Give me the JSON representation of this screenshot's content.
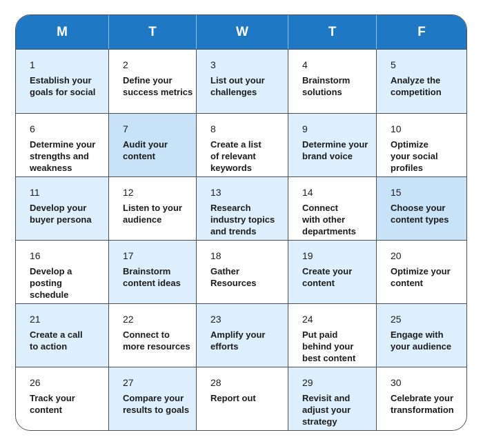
{
  "colors": {
    "header": "#1f78c4",
    "light": "#ddeffd",
    "mid": "#c8e2f7",
    "white": "#ffffff",
    "border": "#4a4f55"
  },
  "days": [
    "M",
    "T",
    "W",
    "T",
    "F"
  ],
  "cells": [
    {
      "num": "1",
      "task": "Establish your\ngoals for social",
      "shade": "light"
    },
    {
      "num": "2",
      "task": "Define your\nsuccess metrics",
      "shade": "white"
    },
    {
      "num": "3",
      "task": "List out your\nchallenges",
      "shade": "light"
    },
    {
      "num": "4",
      "task": "Brainstorm\nsolutions",
      "shade": "white"
    },
    {
      "num": "5",
      "task": "Analyze the\ncompetition",
      "shade": "light"
    },
    {
      "num": "6",
      "task": "Determine your\nstrengths and\nweakness",
      "shade": "white"
    },
    {
      "num": "7",
      "task": "Audit your\ncontent",
      "shade": "mid"
    },
    {
      "num": "8",
      "task": "Create a list\nof relevant\nkeywords",
      "shade": "white"
    },
    {
      "num": "9",
      "task": "Determine your\nbrand voice",
      "shade": "light"
    },
    {
      "num": "10",
      "task": "Optimize\nyour social\nprofiles",
      "shade": "white"
    },
    {
      "num": "11",
      "task": "Develop your\nbuyer persona",
      "shade": "light"
    },
    {
      "num": "12",
      "task": "Listen to your\naudience",
      "shade": "white"
    },
    {
      "num": "13",
      "task": "Research\nindustry topics\nand trends",
      "shade": "light"
    },
    {
      "num": "14",
      "task": "Connect\nwith other\ndepartments",
      "shade": "white"
    },
    {
      "num": "15",
      "task": "Choose your\ncontent types",
      "shade": "mid"
    },
    {
      "num": "16",
      "task": "Develop a\nposting\nschedule",
      "shade": "white"
    },
    {
      "num": "17",
      "task": "Brainstorm\ncontent ideas",
      "shade": "light"
    },
    {
      "num": "18",
      "task": "Gather\nResources",
      "shade": "white"
    },
    {
      "num": "19",
      "task": "Create your\ncontent",
      "shade": "light"
    },
    {
      "num": "20",
      "task": "Optimize your\ncontent",
      "shade": "white"
    },
    {
      "num": "21",
      "task": "Create a call\nto action",
      "shade": "light"
    },
    {
      "num": "22",
      "task": "Connect to\nmore resources",
      "shade": "white"
    },
    {
      "num": "23",
      "task": "Amplify your\nefforts",
      "shade": "light"
    },
    {
      "num": "24",
      "task": "Put paid\nbehind your\nbest content",
      "shade": "white"
    },
    {
      "num": "25",
      "task": "Engage with\nyour audience",
      "shade": "light"
    },
    {
      "num": "26",
      "task": "Track your\ncontent",
      "shade": "white"
    },
    {
      "num": "27",
      "task": "Compare your\nresults to goals",
      "shade": "light"
    },
    {
      "num": "28",
      "task": "Report out",
      "shade": "white"
    },
    {
      "num": "29",
      "task": "Revisit and\nadjust your\nstrategy",
      "shade": "light"
    },
    {
      "num": "30",
      "task": "Celebrate your\ntransformation",
      "shade": "white"
    }
  ]
}
